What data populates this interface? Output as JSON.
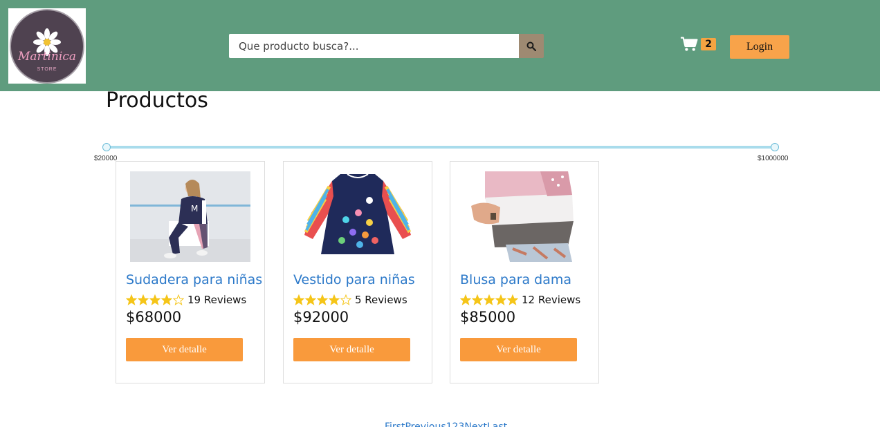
{
  "header": {
    "logo": {
      "text": "Martinica",
      "subtext": "STORE"
    },
    "search": {
      "placeholder": "Que producto busca?..."
    },
    "cart": {
      "count": "2"
    },
    "login_label": "Login"
  },
  "main": {
    "title": "Productos",
    "price_filter": {
      "min_label": "$20000",
      "max_label": "$1000000",
      "min_fraction": 0,
      "max_fraction": 1
    },
    "products": [
      {
        "name": "Sudadera para niñas",
        "rating": 4,
        "reviews": "19 Reviews",
        "price": "$68000",
        "button_label": "Ver detalle"
      },
      {
        "name": "Vestido para niñas",
        "rating": 4,
        "reviews": "5 Reviews",
        "price": "$92000",
        "button_label": "Ver detalle"
      },
      {
        "name": "Blusa para dama",
        "rating": 5,
        "reviews": "12 Reviews",
        "price": "$85000",
        "button_label": "Ver detalle"
      }
    ],
    "pagination_text": "FirstPrevious123NextLast"
  },
  "colors": {
    "header_bg": "#5f9c7e",
    "accent_orange": "#f99a3c",
    "link_blue": "#2c79c9",
    "star_gold": "#f5c518"
  }
}
